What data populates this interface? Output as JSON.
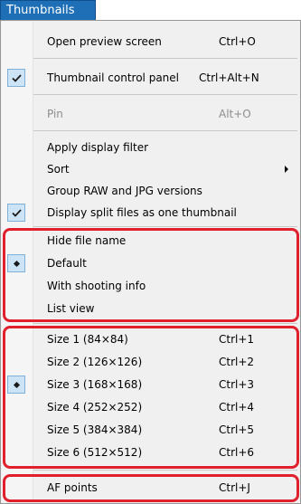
{
  "menu": {
    "tab_label": "Thumbnails",
    "items": [
      {
        "label": "Open preview screen",
        "shortcut": "Ctrl+O"
      },
      {
        "label": "Thumbnail control panel",
        "shortcut": "Ctrl+Alt+N"
      },
      {
        "label": "Pin",
        "shortcut": "Alt+O"
      },
      {
        "label": "Apply display filter"
      },
      {
        "label": "Sort"
      },
      {
        "label": "Group RAW and JPG versions"
      },
      {
        "label": "Display split files as one thumbnail"
      },
      {
        "label": "Hide file name"
      },
      {
        "label": "Default"
      },
      {
        "label": "With shooting info"
      },
      {
        "label": "List view"
      },
      {
        "label": "Size 1 (84×84)",
        "shortcut": "Ctrl+1"
      },
      {
        "label": "Size 2 (126×126)",
        "shortcut": "Ctrl+2"
      },
      {
        "label": "Size 3 (168×168)",
        "shortcut": "Ctrl+3"
      },
      {
        "label": "Size 4 (252×252)",
        "shortcut": "Ctrl+4"
      },
      {
        "label": "Size 5 (384×384)",
        "shortcut": "Ctrl+5"
      },
      {
        "label": "Size 6 (512×512)",
        "shortcut": "Ctrl+6"
      },
      {
        "label": "AF points",
        "shortcut": "Ctrl+J"
      }
    ]
  },
  "colors": {
    "tab_background": "#1f6fb7",
    "highlight_border": "#e0202d",
    "disabled_text": "#8d8d8d"
  },
  "icons": {
    "checked": "checkmark-icon",
    "selected_radio": "diamond-bullet-icon",
    "submenu": "submenu-arrow-icon"
  }
}
